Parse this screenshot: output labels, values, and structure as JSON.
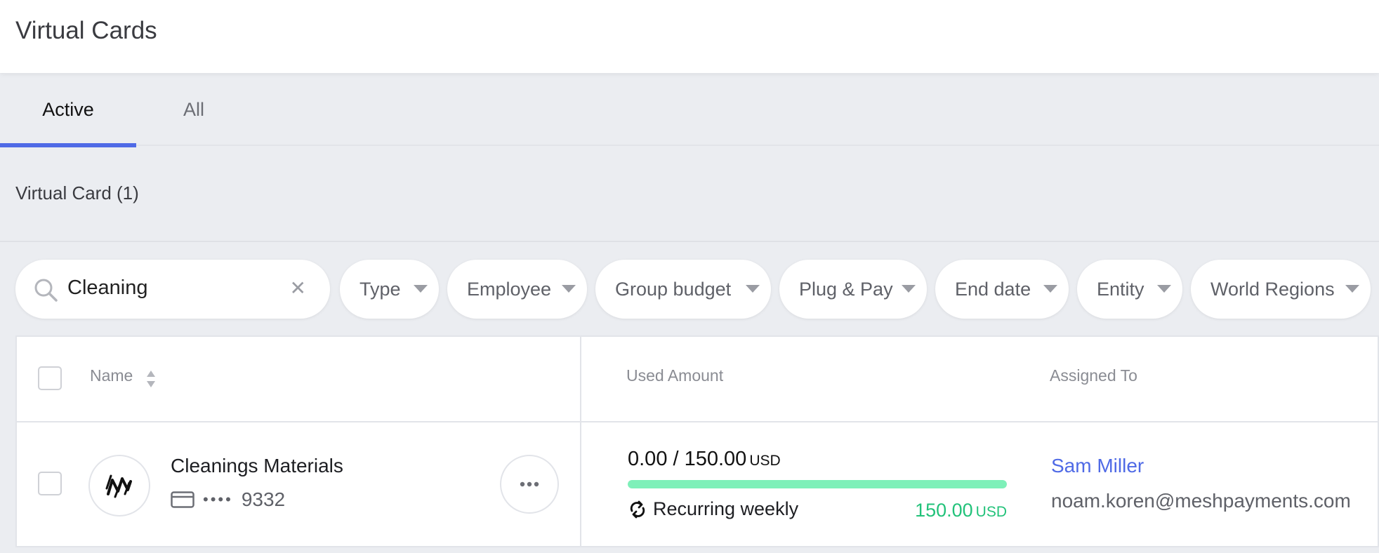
{
  "header": {
    "title": "Virtual Cards"
  },
  "tabs": [
    {
      "label": "Active",
      "active": true
    },
    {
      "label": "All",
      "active": false
    }
  ],
  "section": {
    "title": "Virtual Card (1)"
  },
  "search": {
    "value": "Cleaning"
  },
  "filters": [
    {
      "label": "Type"
    },
    {
      "label": "Employee"
    },
    {
      "label": "Group budget"
    },
    {
      "label": "Plug & Pay"
    },
    {
      "label": "End date"
    },
    {
      "label": "Entity"
    },
    {
      "label": "World Regions"
    }
  ],
  "table": {
    "columns": {
      "name": "Name",
      "used_amount": "Used Amount",
      "assigned_to": "Assigned To"
    },
    "rows": [
      {
        "name": "Cleanings Materials",
        "card_mask": "•••• ",
        "card_last4": "9332",
        "amount_text": "0.00 / 150.00",
        "amount_currency": "USD",
        "progress": 1.0,
        "recurring": "Recurring weekly",
        "remaining_amount": "150.00",
        "remaining_currency": "USD",
        "assignee_name": "Sam Miller",
        "assignee_email": "noam.koren@meshpayments.com"
      }
    ]
  },
  "colors": {
    "accent": "#4f6ae6",
    "progress": "#7ef0b9",
    "positive": "#22c27a"
  }
}
